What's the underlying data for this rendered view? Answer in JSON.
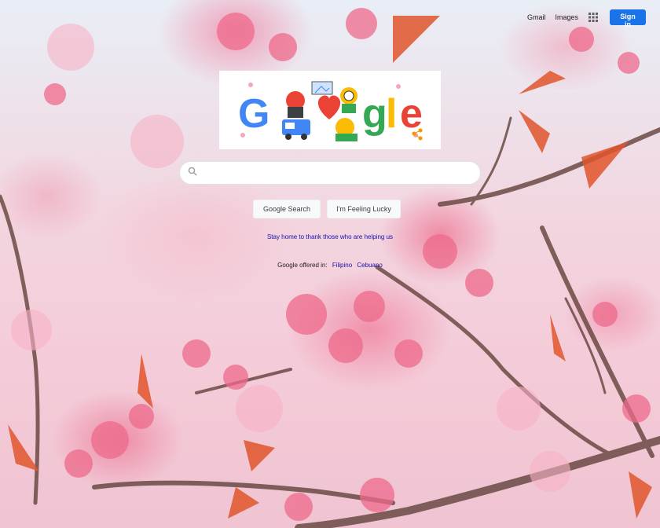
{
  "topbar": {
    "gmail_label": "Gmail",
    "images_label": "Images",
    "signin_label": "Sign in",
    "apps_icon": "apps-grid-icon"
  },
  "doodle": {
    "letters": [
      "G",
      "o",
      "o",
      "g",
      "l",
      "e"
    ],
    "colors": {
      "blue": "#4285f4",
      "red": "#ea4335",
      "yellow": "#fbbc05",
      "green": "#34a853"
    }
  },
  "search": {
    "icon": "search-icon",
    "value": "",
    "placeholder": ""
  },
  "buttons": {
    "search_label": "Google Search",
    "lucky_label": "I'm Feeling Lucky"
  },
  "promo": {
    "text": "Stay home to thank those who are helping us"
  },
  "languages": {
    "offered_label": "Google offered in:",
    "items": [
      "Filipino",
      "Cebuano"
    ]
  },
  "colors": {
    "accent": "#1a73e8",
    "link": "#1a0dab"
  }
}
